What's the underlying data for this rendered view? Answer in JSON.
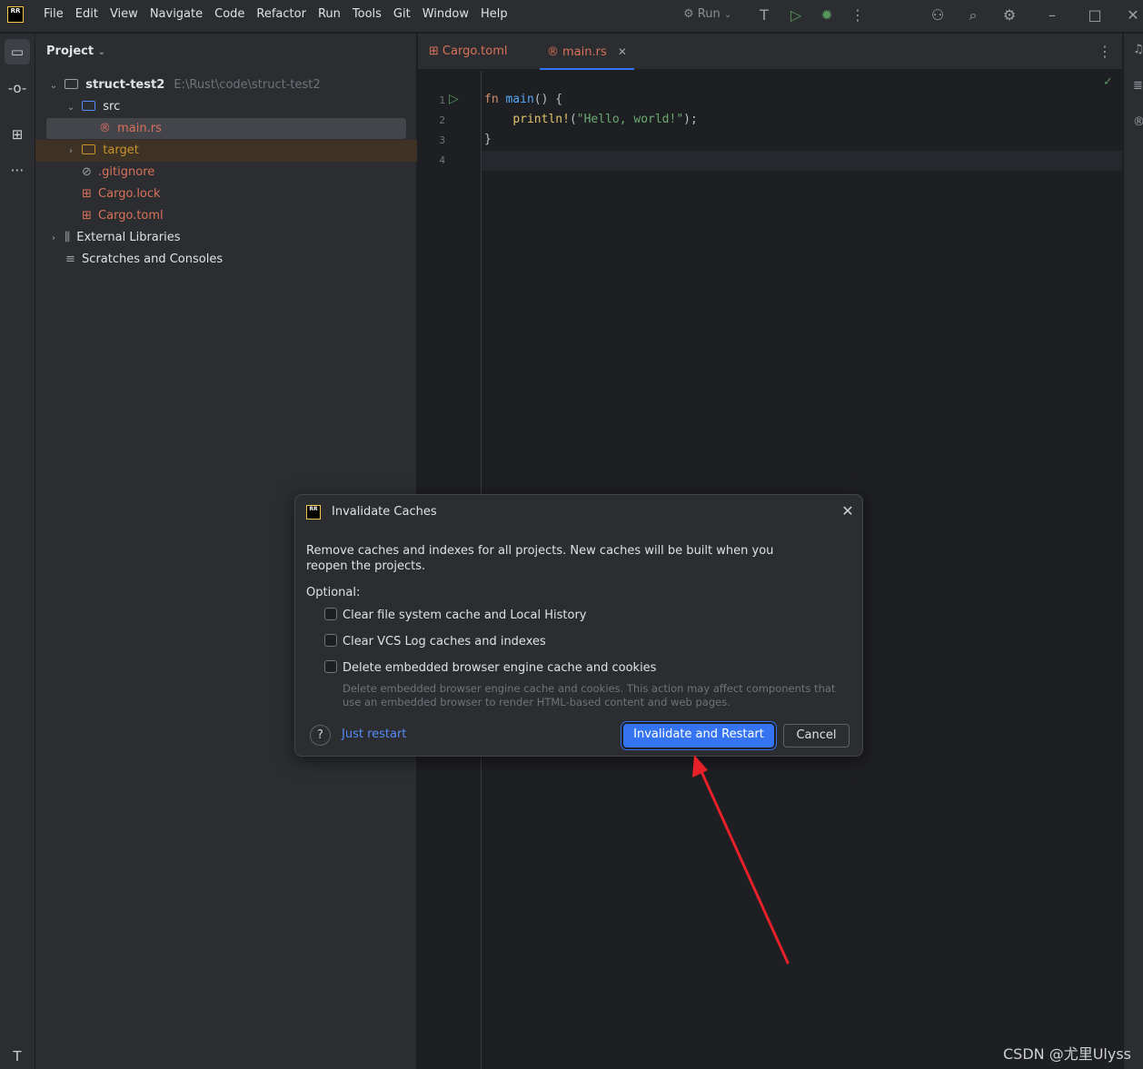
{
  "app": {
    "logo_text": "RR"
  },
  "menu": [
    "File",
    "Edit",
    "View",
    "Navigate",
    "Code",
    "Refactor",
    "Run",
    "Tools",
    "Git",
    "Window",
    "Help"
  ],
  "toolbar": {
    "run_label": "Run"
  },
  "project_panel": {
    "title": "Project",
    "tree": [
      {
        "label": "struct-test2",
        "path": "E:\\Rust\\code\\struct-test2"
      },
      {
        "label": "src"
      },
      {
        "label": "main.rs"
      },
      {
        "label": "target"
      },
      {
        "label": ".gitignore"
      },
      {
        "label": "Cargo.lock"
      },
      {
        "label": "Cargo.toml"
      },
      {
        "label": "External Libraries"
      },
      {
        "label": "Scratches and Consoles"
      }
    ]
  },
  "editor": {
    "tabs": [
      {
        "label": "Cargo.toml"
      },
      {
        "label": "main.rs"
      }
    ],
    "line_numbers": [
      "1",
      "2",
      "3",
      "4"
    ],
    "code": {
      "l1_kw": "fn ",
      "l1_fn": "main",
      "l1_rest": "() {",
      "l2_indent": "    ",
      "l2_macro": "println!",
      "l2_open": "(",
      "l2_str": "\"Hello, world!\"",
      "l2_close": ");",
      "l3": "}"
    }
  },
  "dialog": {
    "title": "Invalidate Caches",
    "message": "Remove caches and indexes for all projects. New caches will be built when you reopen the projects.",
    "optional_label": "Optional:",
    "options": [
      {
        "label": "Clear file system cache and Local History",
        "checked": false
      },
      {
        "label": "Clear VCS Log caches and indexes",
        "checked": false
      },
      {
        "label": "Delete embedded browser engine cache and cookies",
        "checked": false
      }
    ],
    "option_description": "Delete embedded browser engine cache and cookies. This action may affect components that use an embedded browser to render HTML-based content and web pages.",
    "help_label": "?",
    "just_restart": "Just restart",
    "primary_button": "Invalidate and Restart",
    "cancel_button": "Cancel"
  },
  "watermark": "CSDN @尤里Ulyss",
  "colors": {
    "accent": "#3574f0",
    "annotation_arrow": "#e8202a"
  }
}
